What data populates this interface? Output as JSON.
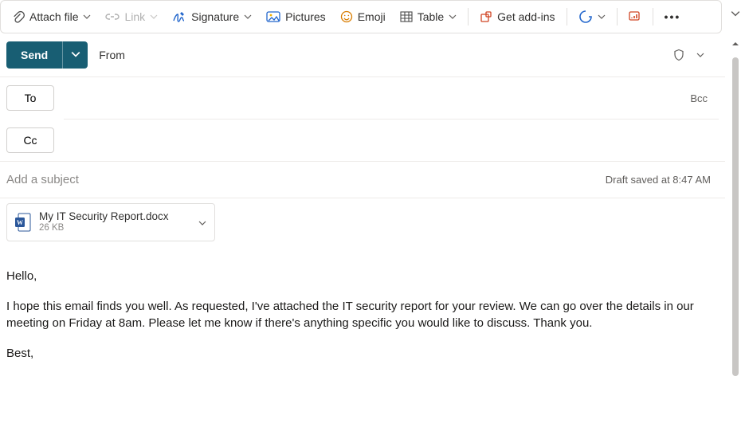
{
  "toolbar": {
    "attach": "Attach file",
    "link": "Link",
    "signature": "Signature",
    "pictures": "Pictures",
    "emoji": "Emoji",
    "table": "Table",
    "addins": "Get add-ins"
  },
  "send": {
    "label": "Send",
    "from": "From"
  },
  "recipients": {
    "to": "To",
    "cc": "Cc",
    "bcc": "Bcc"
  },
  "subject": {
    "placeholder": "Add a subject",
    "value": ""
  },
  "status": {
    "draft": "Draft saved at 8:47 AM"
  },
  "attachment": {
    "name": "My IT Security Report.docx",
    "size": "26 KB"
  },
  "body": {
    "greeting": "Hello,",
    "para1": "I hope this email finds you well. As requested, I've attached the IT security report for your review. We can go over the details in our meeting on Friday at 8am. Please let me know if there's anything specific you would like to discuss. Thank you.",
    "signoff": "Best,"
  }
}
